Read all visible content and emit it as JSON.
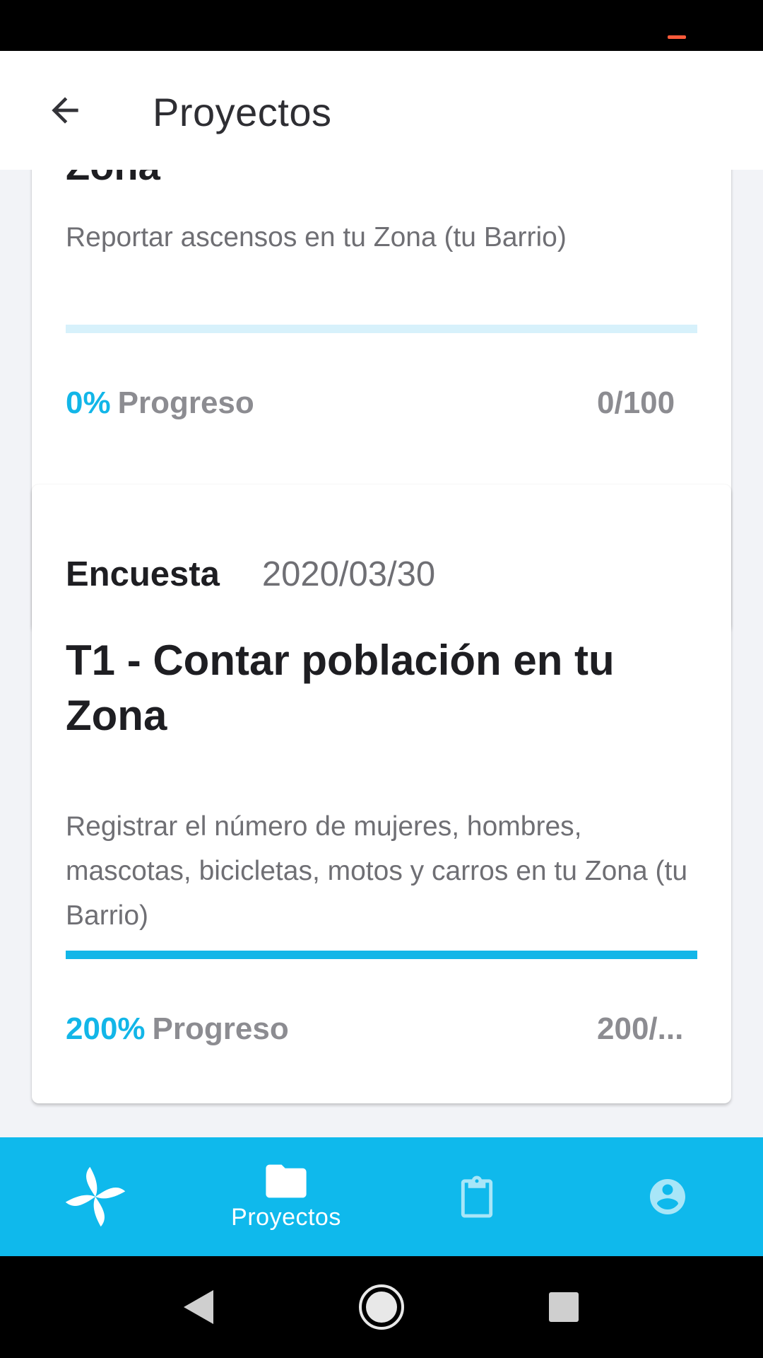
{
  "app_bar": {
    "title": "Proyectos"
  },
  "cards": [
    {
      "title_partial": "Zona",
      "description": "Reportar ascensos en tu Zona (tu Barrio)",
      "progress_percent_label": "0%",
      "progress_label": "Progreso",
      "count": "0/100",
      "progress_fraction": 0.0
    },
    {
      "type": "Encuesta",
      "date": "2020/03/30",
      "title": "T1 - Contar población en tu Zona",
      "description": "Registrar el número de mujeres, hombres, mascotas, bicicletas, motos y carros en tu Zona (tu Barrio)",
      "progress_percent_label": "200%",
      "progress_label": "Progreso",
      "count": "200/...",
      "progress_fraction": 1.0
    }
  ],
  "bottom_nav": {
    "items": [
      {
        "icon": "pinwheel-icon",
        "label": ""
      },
      {
        "icon": "folder-icon",
        "label": "Proyectos"
      },
      {
        "icon": "clipboard-icon",
        "label": ""
      },
      {
        "icon": "account-circle-icon",
        "label": ""
      }
    ]
  },
  "colors": {
    "accent": "#12b6e8",
    "nav_background": "#0fb9ec",
    "track_light": "#d7f1fb",
    "status_indicator": "#ff5b3a"
  }
}
